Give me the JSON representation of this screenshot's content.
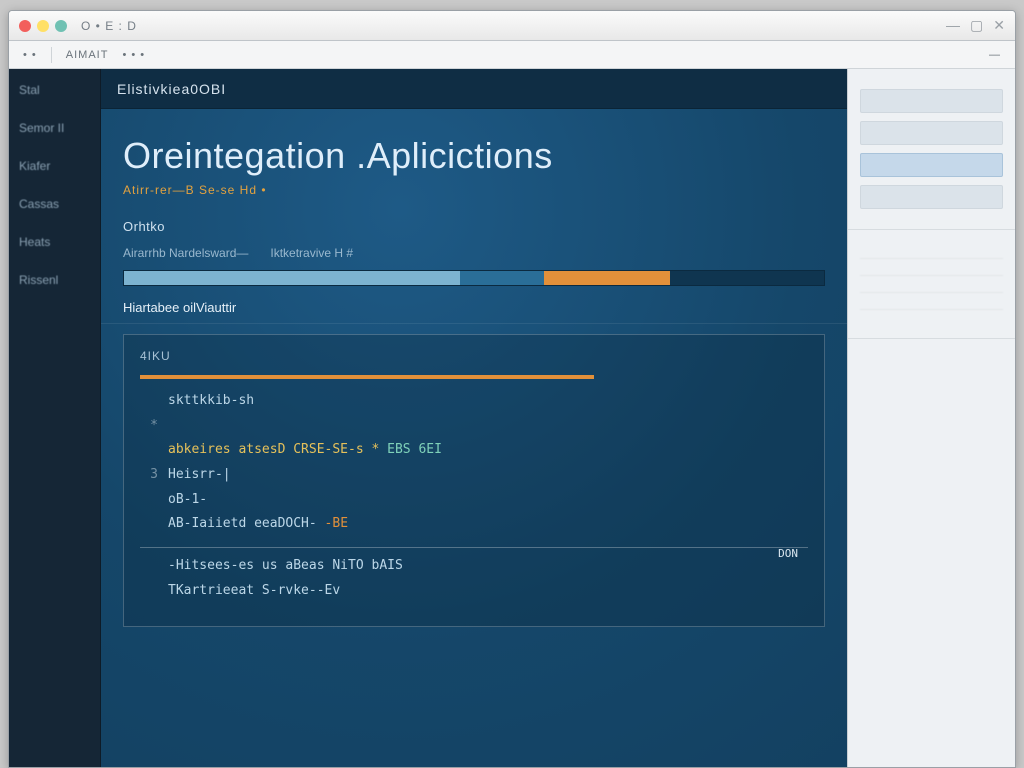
{
  "window": {
    "title": "O • E : D",
    "right_icons": [
      "minimize-icon",
      "maximize-icon",
      "close-icon"
    ]
  },
  "toolbar": {
    "items": [
      "•  •",
      "AIMAIT",
      "•  • •",
      "—"
    ]
  },
  "sidebar_left": {
    "items": [
      {
        "label": "Stal"
      },
      {
        "label": "Semor II"
      },
      {
        "label": "Kiafer"
      },
      {
        "label": "Cassas"
      },
      {
        "label": "Heats"
      },
      {
        "label": "Rissenl"
      }
    ]
  },
  "header": {
    "tab_label": "Elistivkiea0OBI"
  },
  "page": {
    "title": "Oreintegation .Aplicictions",
    "subline": "Atirr-rer—B Se-se Hd •",
    "section": "Orhtko",
    "tabs": [
      "Airarrhb Nardelsward—",
      "Iktketravive H #"
    ],
    "progress": {
      "seg_a_pct": 48,
      "seg_b_pct": 12,
      "seg_c_pct": 18
    },
    "subsection": "Hiartabee oilViauttir",
    "panel": {
      "field_label": "4IKU",
      "mini_bar_pct": 68,
      "code": [
        {
          "n": "",
          "text": "skttkkib-sh",
          "cls": ""
        },
        {
          "n": "*",
          "text": "",
          "cls": ""
        },
        {
          "n": "",
          "text": "abkeires atsesD CRSE-SE-s *",
          "cls": "kw",
          "tail": " EBS 6EI",
          "tail_cls": "str"
        },
        {
          "n": "3",
          "text": "Heisrr-|",
          "cls": ""
        },
        {
          "n": "",
          "text": "oB-1-",
          "cls": ""
        },
        {
          "n": "",
          "text": "AB-Iaiietd eeaDOCH-",
          "cls": "",
          "tail": " -BE",
          "tail_cls": "op"
        },
        {
          "n": "",
          "text": "-Hitsees-es us aBeas NiTO bAIS",
          "cls": "",
          "annot": "DON"
        },
        {
          "n": "",
          "text": "TKartrieeat S-rvke--Ev",
          "cls": ""
        }
      ]
    }
  },
  "sidebar_right": {
    "group1_title": "",
    "group1_items": 4,
    "list": [
      "",
      "",
      "",
      "",
      ""
    ]
  },
  "colors": {
    "accent_orange": "#e2903a",
    "bg_main": "#15476a"
  }
}
